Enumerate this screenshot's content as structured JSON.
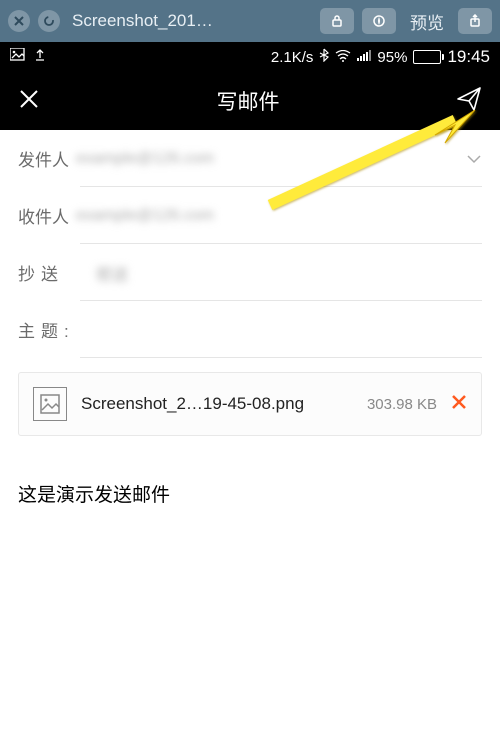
{
  "browser": {
    "tab_title": "Screenshot_201…",
    "preview_label": "预览"
  },
  "status": {
    "speed": "2.1K/s",
    "battery_pct": "95%",
    "time": "19:45"
  },
  "header": {
    "title": "写邮件"
  },
  "fields": {
    "sender_label": "发件人",
    "sender_value": "example@126.com",
    "recipient_label": "收件人",
    "recipient_value": "example@126.com",
    "cc_label": "抄送",
    "cc_value": "密送",
    "subject_label": "主题",
    "subject_value": ""
  },
  "attachment": {
    "name": "Screenshot_2…19-45-08.png",
    "size": "303.98 KB"
  },
  "body": "这是演示发送邮件"
}
